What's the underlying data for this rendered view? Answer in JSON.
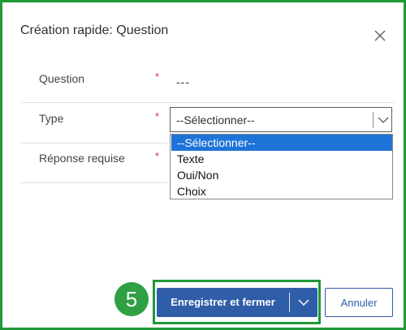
{
  "dialog": {
    "title": "Création rapide: Question"
  },
  "fields": {
    "question": {
      "label": "Question",
      "required_mark": "*",
      "value": "---"
    },
    "type": {
      "label": "Type",
      "required_mark": "*",
      "selected": "--Sélectionner--"
    },
    "reponse": {
      "label": "Réponse requise",
      "required_mark": "*"
    }
  },
  "dropdown": {
    "options": [
      "--Sélectionner--",
      "Texte",
      "Oui/Non",
      "Choix"
    ],
    "highlighted_index": 0
  },
  "footer": {
    "save_close_label": "Enregistrer et fermer",
    "cancel_label": "Annuler",
    "step_badge": "5"
  },
  "icons": {
    "close": "close-icon",
    "select_caret": "chevron-down-icon",
    "split_caret": "chevron-down-icon"
  },
  "colors": {
    "primary": "#2f5da8",
    "highlight": "#1e73d8",
    "required": "#d13438",
    "annotation": "#1f9a37"
  }
}
